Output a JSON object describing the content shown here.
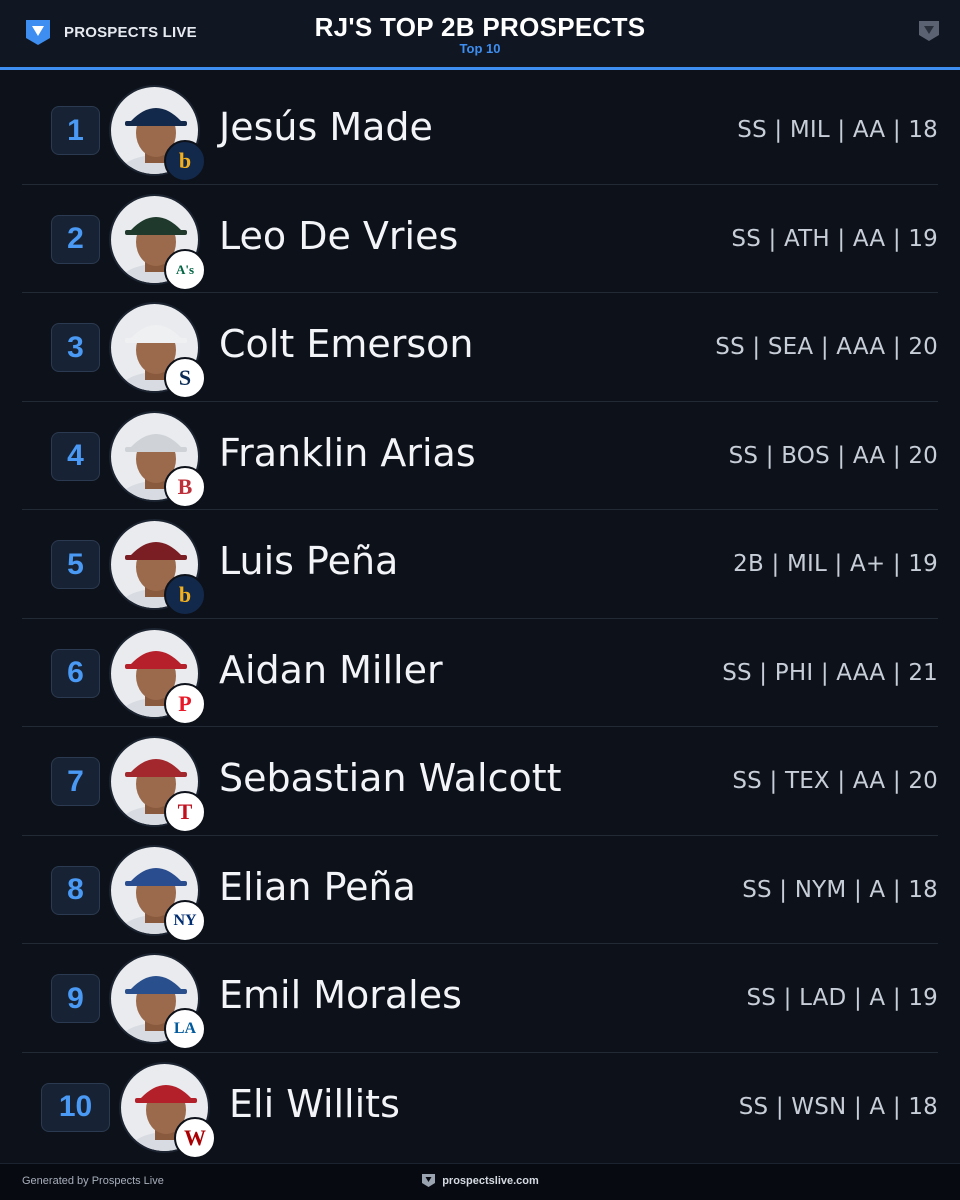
{
  "header": {
    "brand_name": "PROSPECTS LIVE",
    "title": "RJ'S TOP 2B PROSPECTS",
    "subtitle": "Top 10",
    "accent_color": "#3d8ef0"
  },
  "prospects": [
    {
      "rank": "1",
      "name": "Jesús Made",
      "meta": "SS | MIL | AA | 18",
      "team_icon": "brewers-logo-icon",
      "logo_text": "b",
      "logo_color": "#f2b01e",
      "logo_bg": "#13294b",
      "cap_color": "#13294b"
    },
    {
      "rank": "2",
      "name": "Leo De Vries",
      "meta": "SS | ATH | AA | 19",
      "team_icon": "athletics-logo-icon",
      "logo_text": "A's",
      "logo_color": "#006341",
      "logo_bg": "#ffffff",
      "cap_color": "#1f3a2d"
    },
    {
      "rank": "3",
      "name": "Colt Emerson",
      "meta": "SS | SEA | AAA | 20",
      "team_icon": "mariners-logo-icon",
      "logo_text": "S",
      "logo_color": "#0c2c56",
      "logo_bg": "#ffffff",
      "cap_color": "#eef0f2"
    },
    {
      "rank": "4",
      "name": "Franklin Arias",
      "meta": "SS | BOS | AA | 20",
      "team_icon": "red-sox-logo-icon",
      "logo_text": "B",
      "logo_color": "#bd3039",
      "logo_bg": "#ffffff",
      "cap_color": "#cfd3d8"
    },
    {
      "rank": "5",
      "name": "Luis Peña",
      "meta": "2B | MIL | A+ | 19",
      "team_icon": "brewers-logo-icon",
      "logo_text": "b",
      "logo_color": "#f2b01e",
      "logo_bg": "#13294b",
      "cap_color": "#7a1e24"
    },
    {
      "rank": "6",
      "name": "Aidan Miller",
      "meta": "SS | PHI | AAA | 21",
      "team_icon": "phillies-logo-icon",
      "logo_text": "P",
      "logo_color": "#e81828",
      "logo_bg": "#ffffff",
      "cap_color": "#b5202b"
    },
    {
      "rank": "7",
      "name": "Sebastian Walcott",
      "meta": "SS | TEX | AA | 20",
      "team_icon": "rangers-logo-icon",
      "logo_text": "T",
      "logo_color": "#c0111f",
      "logo_bg": "#ffffff",
      "cap_color": "#a3282e"
    },
    {
      "rank": "8",
      "name": "Elian Peña",
      "meta": "SS | NYM | A | 18",
      "team_icon": "mets-logo-icon",
      "logo_text": "NY",
      "logo_color": "#002d72",
      "logo_bg": "#ffffff",
      "cap_color": "#2a4d8f"
    },
    {
      "rank": "9",
      "name": "Emil Morales",
      "meta": "SS | LAD | A | 19",
      "team_icon": "dodgers-logo-icon",
      "logo_text": "LA",
      "logo_color": "#005a9c",
      "logo_bg": "#ffffff",
      "cap_color": "#2a4f8d"
    },
    {
      "rank": "10",
      "name": "Eli Willits",
      "meta": "SS | WSN | A | 18",
      "team_icon": "nationals-logo-icon",
      "logo_text": "W",
      "logo_color": "#ab0003",
      "logo_bg": "#ffffff",
      "cap_color": "#b3202a"
    }
  ],
  "footer": {
    "generated_by": "Generated by Prospects Live",
    "site": "prospectslive.com"
  },
  "colors": {
    "background": "#0d1119",
    "rank_text": "#4a9af5",
    "rank_badge_bg": "#172335"
  }
}
